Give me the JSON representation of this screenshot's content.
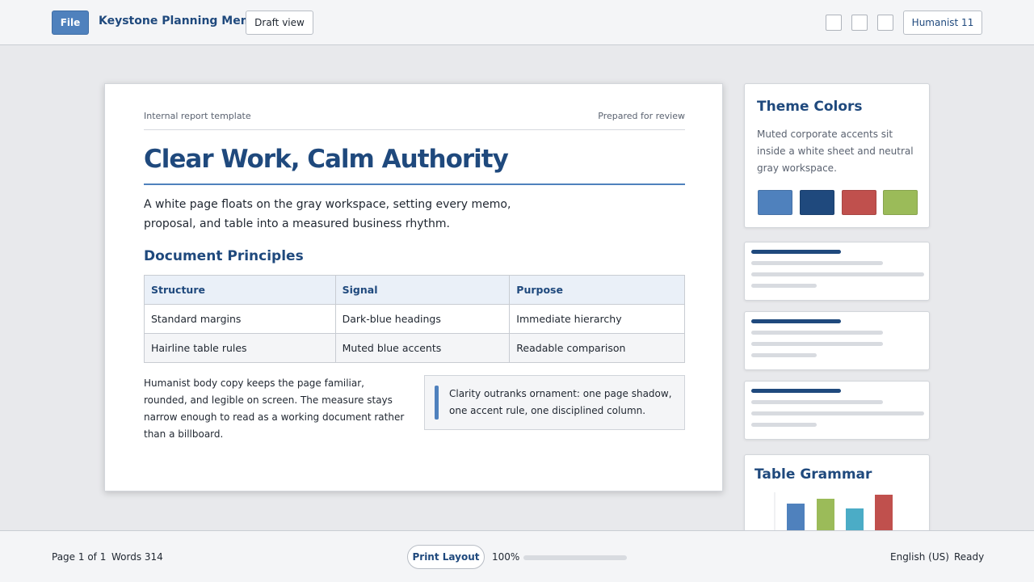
{
  "topbar": {
    "file_label": "File",
    "doc_title": "Keystone Planning Memo",
    "draft_label": "Draft view",
    "font_label": "Humanist 11"
  },
  "page": {
    "header_left": "Internal report template",
    "header_right": "Prepared for review",
    "headline": "Clear Work, Calm Authority",
    "lead": "A white page floats on the gray workspace, setting every memo, proposal, and table into a measured business rhythm.",
    "section_heading": "Document Principles",
    "table": {
      "headers": [
        "Structure",
        "Signal",
        "Purpose"
      ],
      "rows": [
        [
          "Standard margins",
          "Dark-blue headings",
          "Immediate hierarchy"
        ],
        [
          "Hairline table rules",
          "Muted blue accents",
          "Readable comparison"
        ]
      ]
    },
    "body_copy": "Humanist body copy keeps the page familiar, rounded, and legible on screen. The measure stays narrow enough to read as a working document rather than a billboard.",
    "callout": "Clarity outranks ornament: one page shadow, one accent rule, one disciplined column."
  },
  "sidebar": {
    "theme_title": "Theme Colors",
    "theme_desc": "Muted corporate accents sit inside a white sheet and neutral gray workspace.",
    "swatches": [
      "#4f81bd",
      "#1f497d",
      "#c0504d",
      "#9bbb59"
    ],
    "grammar_title": "Table Grammar",
    "grammar_bar_colors": [
      "#4f81bd",
      "#9bbb59",
      "#4bacc6",
      "#c0504d"
    ]
  },
  "statusbar": {
    "page_info": "Page 1 of 1",
    "words": "Words 314",
    "print_layout": "Print Layout",
    "zoom": "100%",
    "language": "English (US)",
    "status": "Ready"
  }
}
